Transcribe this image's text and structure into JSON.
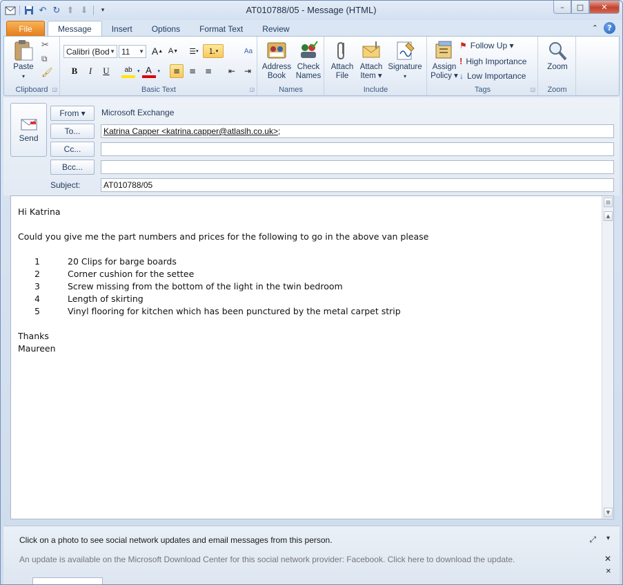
{
  "window": {
    "title": "AT010788/05  -  Message (HTML)",
    "controls": {
      "minimize": "–",
      "maximize": "□",
      "close": "✕"
    }
  },
  "tabs": [
    "File",
    "Message",
    "Insert",
    "Options",
    "Format Text",
    "Review"
  ],
  "ribbon": {
    "clipboard": {
      "label": "Clipboard",
      "paste": "Paste"
    },
    "basic_text": {
      "label": "Basic Text",
      "font": "Calibri (Body)",
      "font_short": "Calibri (Bod",
      "size": "11"
    },
    "names": {
      "label": "Names",
      "address_book": [
        "Address",
        "Book"
      ],
      "check_names": [
        "Check",
        "Names"
      ]
    },
    "include": {
      "label": "Include",
      "attach_file": [
        "Attach",
        "File"
      ],
      "attach_item": [
        "Attach",
        "Item ▾"
      ],
      "signature": [
        "Signature",
        "▾"
      ]
    },
    "tags": {
      "label": "Tags",
      "assign_policy": [
        "Assign",
        "Policy ▾"
      ],
      "follow_up": "Follow Up ▾",
      "high_importance": "High Importance",
      "low_importance": "Low Importance"
    },
    "zoom": {
      "label": "Zoom",
      "zoom": "Zoom"
    }
  },
  "header": {
    "send": "Send",
    "from_btn": "From ▾",
    "from_value": "Microsoft Exchange",
    "to_btn": "To...",
    "to_value": "Katrina Capper  <katrina.capper@atlaslh.co.uk>",
    "to_suffix": ";",
    "cc_btn": "Cc...",
    "bcc_btn": "Bcc...",
    "subject_label": "Subject:",
    "subject_value": "AT010788/05"
  },
  "body": {
    "greeting": "Hi Katrina",
    "intro": "Could you give me the part numbers and prices for the following to go in the above van please",
    "items": [
      {
        "num": "1",
        "text": "20 Clips for barge boards"
      },
      {
        "num": "2",
        "text": "Corner cushion for the settee"
      },
      {
        "num": "3",
        "text": "Screw missing from the bottom of the light in the twin bedroom"
      },
      {
        "num": "4",
        "text": "Length of skirting"
      },
      {
        "num": "5",
        "text": "Vinyl flooring for kitchen which has been punctured by the metal carpet strip"
      }
    ],
    "closing": "Thanks",
    "signature": "Maureen"
  },
  "people_pane": {
    "message": "Click on a photo to see social network updates and email messages from this person.",
    "update": "An update is available on the Microsoft Download Center for this social network provider: Facebook. Click here to download the update."
  },
  "colors": {
    "file_tab": "#e57a1a",
    "accent": "#1e395b",
    "highlight": "#f9c85d",
    "close": "#c4422e"
  }
}
